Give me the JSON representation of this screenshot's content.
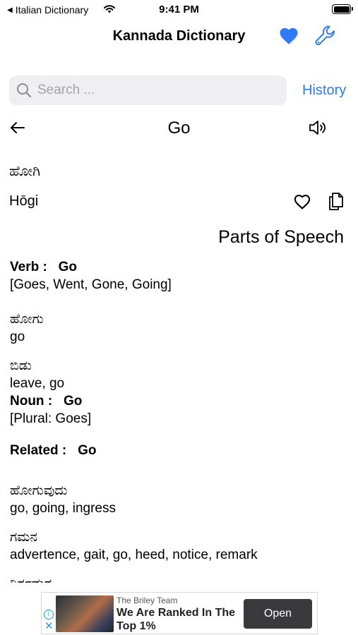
{
  "status_bar": {
    "back_app": "Italian Dictionary",
    "time": "9:41 PM"
  },
  "nav": {
    "title": "Kannada Dictionary",
    "favorite_icon": "heart-fill-icon",
    "settings_icon": "wrench-icon",
    "accent_color": "#2f7bf5"
  },
  "search": {
    "placeholder": "Search ...",
    "value": "",
    "history_label": "History"
  },
  "word": {
    "title": "Go",
    "native": "ಹೋಗಿ",
    "transliteration": "Hōgi"
  },
  "parts_of_speech": {
    "heading": "Parts of Speech",
    "verb_label": "Verb :",
    "verb_word": "Go",
    "verb_forms": "[Goes, Went, Gone, Going]",
    "verb_meanings": [
      {
        "native": "ಹೋಗು",
        "english": "go"
      },
      {
        "native": "ಬಿಡು",
        "english": "leave, go"
      }
    ],
    "noun_label": "Noun :",
    "noun_word": "Go",
    "noun_forms": "[Plural: Goes]",
    "related_label": "Related :",
    "related_word": "Go",
    "related_meanings": [
      {
        "native": "ಹೋಗುವುದು",
        "english": "go, going, ingress"
      },
      {
        "native": "ಗಮನ",
        "english": "advertence, gait, go, heed, notice, remark"
      },
      {
        "native": "ನಿರ್ಗಮನ",
        "english": ""
      }
    ]
  },
  "ad": {
    "advertiser": "The Briley Team",
    "headline": "We Are Ranked In The Top 1%",
    "cta": "Open"
  }
}
